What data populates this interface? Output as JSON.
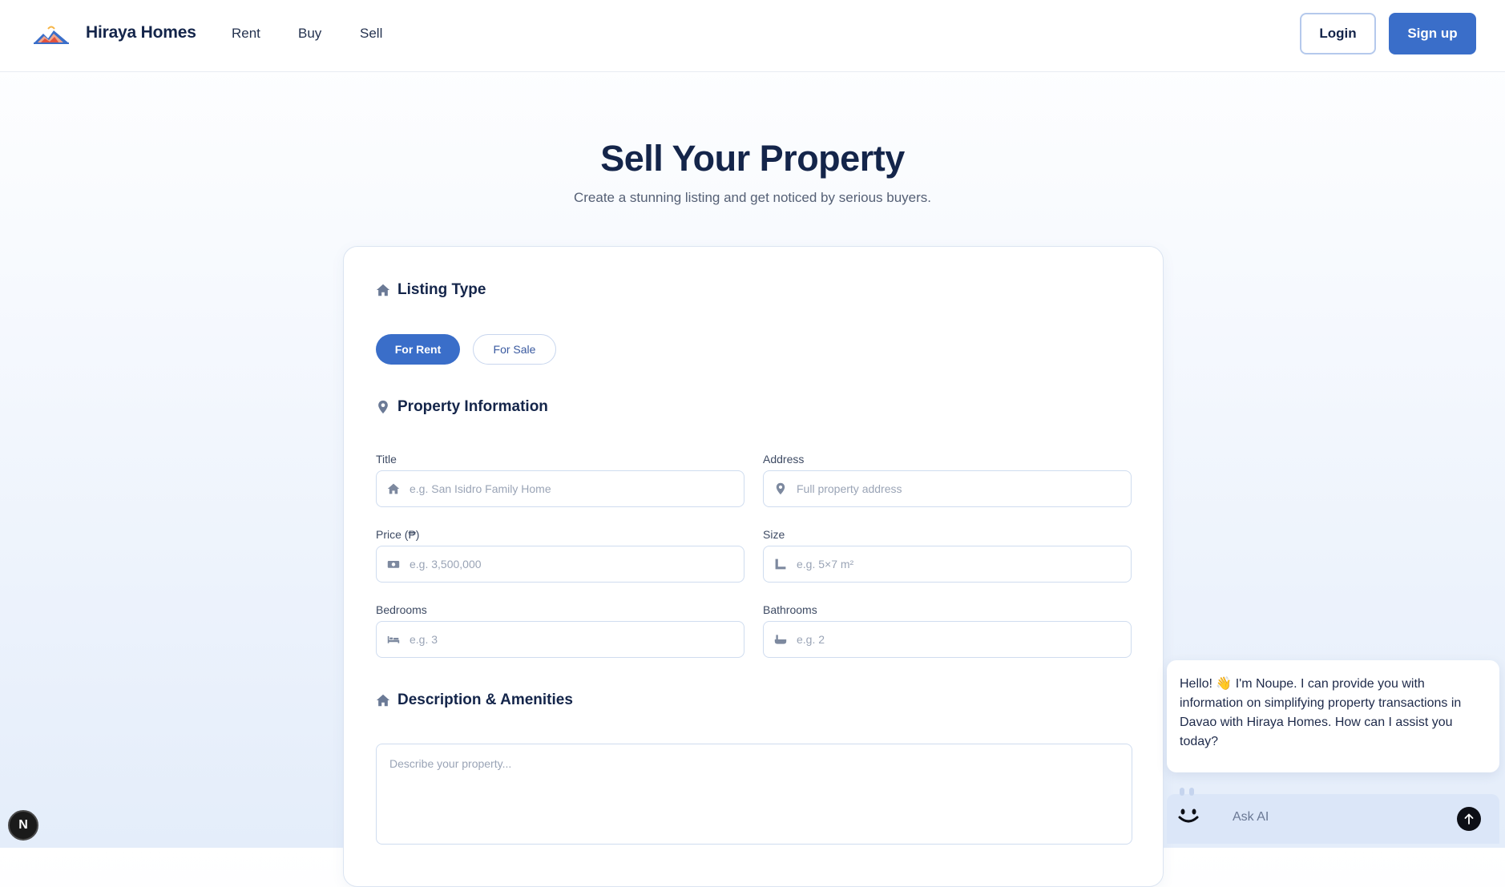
{
  "header": {
    "brand": "Hiraya Homes",
    "nav": [
      "Rent",
      "Buy",
      "Sell"
    ],
    "login_label": "Login",
    "signup_label": "Sign up"
  },
  "hero": {
    "title": "Sell Your Property",
    "subtitle": "Create a stunning listing and get noticed by serious buyers."
  },
  "form": {
    "listing_type": {
      "title": "Listing Type",
      "options": [
        "For Rent",
        "For Sale"
      ],
      "selected": "For Rent"
    },
    "property_info": {
      "title": "Property Information",
      "fields": [
        {
          "label": "Title",
          "placeholder": "e.g. San Isidro Family Home",
          "icon": "home-icon"
        },
        {
          "label": "Address",
          "placeholder": "Full property address",
          "icon": "map-pin-icon"
        },
        {
          "label": "Price (₱)",
          "placeholder": "e.g. 3,500,000",
          "icon": "money-icon"
        },
        {
          "label": "Size",
          "placeholder": "e.g. 5×7 m²",
          "icon": "ruler-icon"
        },
        {
          "label": "Bedrooms",
          "placeholder": "e.g. 3",
          "icon": "bed-icon"
        },
        {
          "label": "Bathrooms",
          "placeholder": "e.g. 2",
          "icon": "bath-icon"
        }
      ]
    },
    "description": {
      "title": "Description & Amenities",
      "placeholder": "Describe your property..."
    }
  },
  "chat": {
    "message": "Hello! 👋 I'm Noupe. I can provide you with information on simplifying property transactions in Davao with Hiraya Homes. How can I assist you today?",
    "input_placeholder": "Ask AI"
  },
  "dev_badge": "N",
  "colors": {
    "primary": "#3a6ec9",
    "heading": "#14254a"
  }
}
